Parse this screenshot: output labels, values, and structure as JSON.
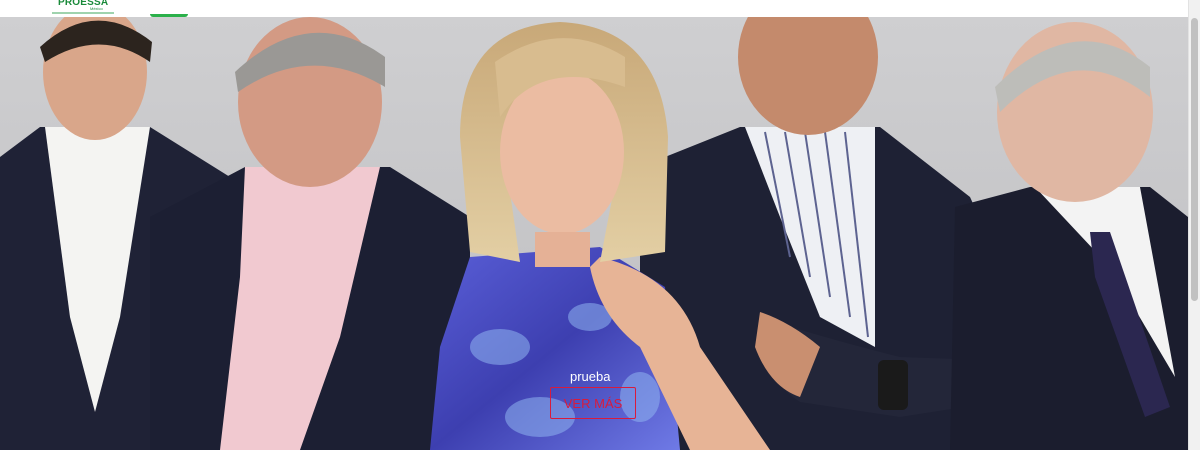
{
  "header": {
    "logo_text": "PROESSA",
    "logo_sub": "México"
  },
  "slide": {
    "caption": "prueba",
    "button_label": "VER MÁS"
  },
  "colors": {
    "brand_green": "#1a8a3a",
    "cta_red": "#d81b3c"
  }
}
